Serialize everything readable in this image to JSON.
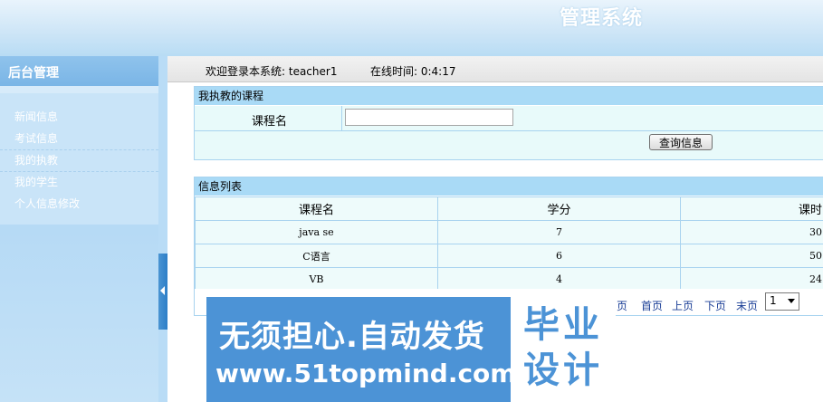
{
  "header": {
    "title": "管理系统"
  },
  "sidebar": {
    "title": "后台管理",
    "items": [
      {
        "label": "新闻信息"
      },
      {
        "label": "考试信息"
      },
      {
        "label": "我的执教"
      },
      {
        "label": "我的学生"
      },
      {
        "label": "个人信息修改"
      }
    ]
  },
  "welcome": {
    "text": "欢迎登录本系统: teacher1",
    "online": "在线时间: 0:4:17"
  },
  "search_panel": {
    "title": "我执教的课程",
    "field_label": "课程名",
    "field_value": "",
    "button_label": "查询信息"
  },
  "list_panel": {
    "title": "信息列表",
    "columns": [
      "课程名",
      "学分",
      "课时"
    ],
    "rows": [
      [
        "java se",
        "7",
        "30"
      ],
      [
        "C语言",
        "6",
        "50"
      ],
      [
        "VB",
        "4",
        "24"
      ]
    ]
  },
  "pager": {
    "total_fragment": "页",
    "first": "首页",
    "prev": "上页",
    "next": "下页",
    "last": "末页",
    "current_page": "1"
  },
  "watermark": {
    "line1": "无须担心.自动发货",
    "line2": "www.51topmind.com",
    "badge": "毕业设计"
  }
}
